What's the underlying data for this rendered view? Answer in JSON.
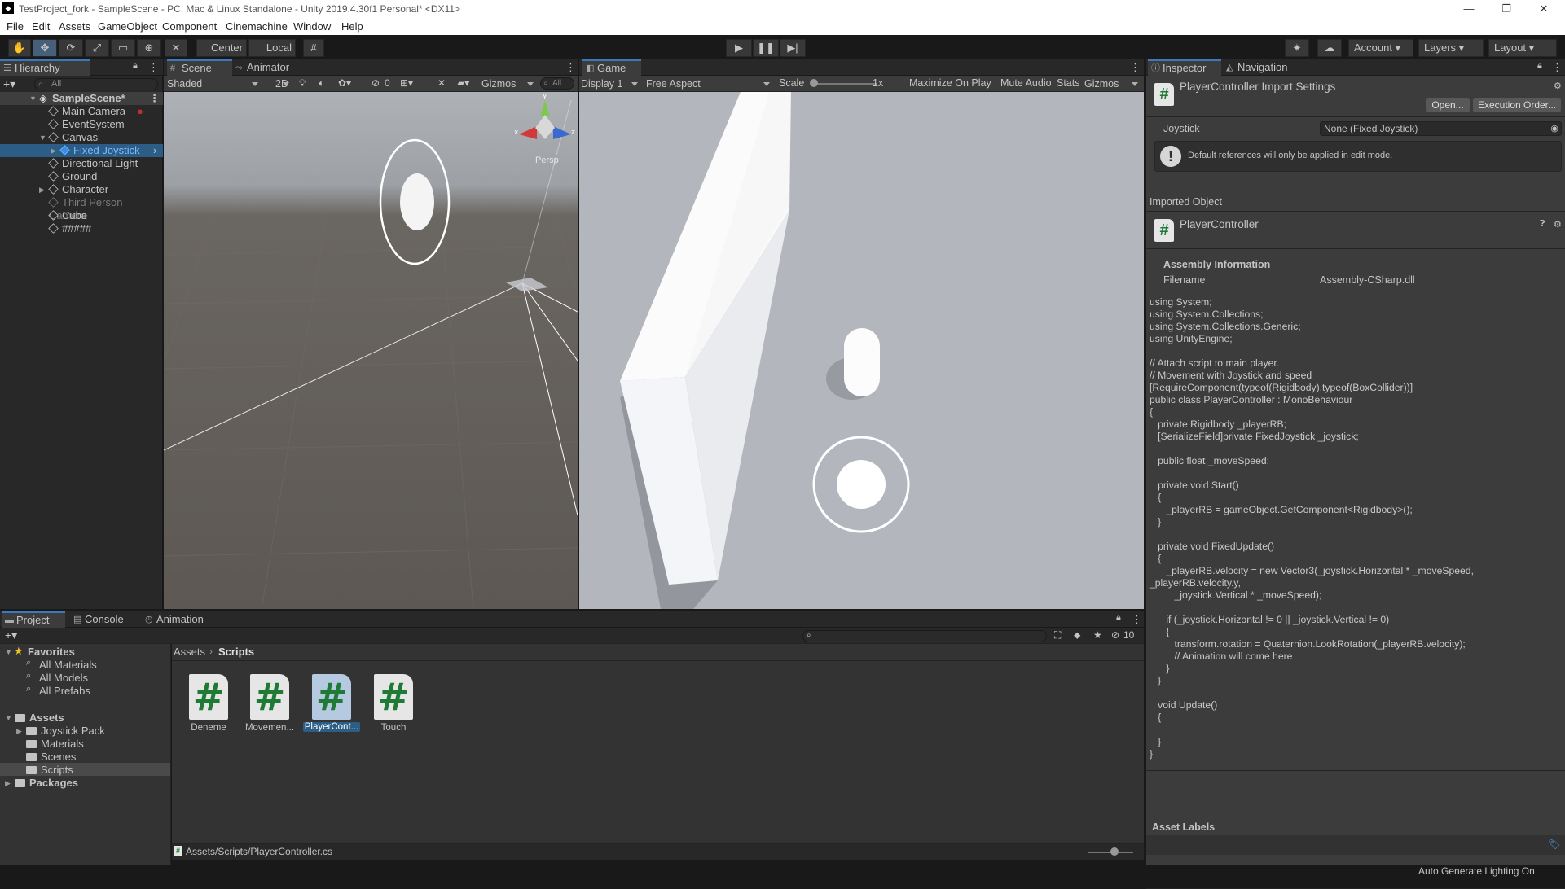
{
  "window": {
    "title": "TestProject_fork - SampleScene - PC, Mac & Linux Standalone - Unity 2019.4.30f1 Personal* <DX11>",
    "app_icon": "unity-logo-icon"
  },
  "menu": [
    "File",
    "Edit",
    "Assets",
    "GameObject",
    "Component",
    "Cinemachine",
    "Window",
    "Help"
  ],
  "toolbar": {
    "pivot": "Center",
    "space": "Local",
    "account": "Account",
    "layers": "Layers",
    "layout": "Layout"
  },
  "hierarchy": {
    "tab": "Hierarchy",
    "search_placeholder": "All",
    "scene": "SampleScene*",
    "items": [
      "Main Camera",
      "EventSystem",
      "Canvas",
      "Fixed Joystick",
      "Directional Light",
      "Ground",
      "Character",
      "Third Person Camera",
      "Cube",
      "#####"
    ]
  },
  "scene": {
    "tabs": [
      "Scene",
      "Animator"
    ],
    "shading": "Shaded",
    "mode2d": "2D",
    "hidden_count": "0",
    "gizmos": "Gizmos",
    "search_placeholder": "All",
    "persp": "Persp",
    "axis_y": "y",
    "axis_x": "x",
    "axis_z": "z"
  },
  "game": {
    "tab": "Game",
    "display": "Display 1",
    "aspect": "Free Aspect",
    "scale_label": "Scale",
    "scale_value": "1x",
    "maximize": "Maximize On Play",
    "mute": "Mute Audio",
    "stats": "Stats",
    "gizmos": "Gizmos"
  },
  "inspector": {
    "tabs": [
      "Inspector",
      "Navigation"
    ],
    "title": "PlayerController Import Settings",
    "open_btn": "Open...",
    "exec_btn": "Execution Order...",
    "joystick_label": "Joystick",
    "joystick_value": "None (Fixed Joystick)",
    "warning": "Default references will only be applied in edit mode.",
    "imported_object": "Imported Object",
    "object_name": "PlayerController",
    "assembly_info": "Assembly Information",
    "filename_label": "Filename",
    "filename_value": "Assembly-CSharp.dll",
    "code": "using System;\nusing System.Collections;\nusing System.Collections.Generic;\nusing UnityEngine;\n\n// Attach script to main player.\n// Movement with Joystick and speed\n[RequireComponent(typeof(Rigidbody),typeof(BoxCollider))]\npublic class PlayerController : MonoBehaviour\n{\n   private Rigidbody _playerRB;\n   [SerializeField]private FixedJoystick _joystick;\n\n   public float _moveSpeed;\n\n   private void Start()\n   {\n      _playerRB = gameObject.GetComponent<Rigidbody>();\n   }\n\n   private void FixedUpdate()\n   {\n      _playerRB.velocity = new Vector3(_joystick.Horizontal * _moveSpeed,\n_playerRB.velocity.y,\n         _joystick.Vertical * _moveSpeed);\n\n      if (_joystick.Horizontal != 0 || _joystick.Vertical != 0)\n      {\n         transform.rotation = Quaternion.LookRotation(_playerRB.velocity);\n         // Animation will come here\n      }\n   }\n\n   void Update()\n   {\n\n   }\n}",
    "asset_labels": "Asset Labels"
  },
  "project": {
    "tabs": [
      "Project",
      "Console",
      "Animation"
    ],
    "hidden_count": "10",
    "favorites": "Favorites",
    "fav_items": [
      "All Materials",
      "All Models",
      "All Prefabs"
    ],
    "assets": "Assets",
    "asset_folders": [
      "Joystick Pack",
      "Materials",
      "Scenes",
      "Scripts"
    ],
    "packages": "Packages",
    "breadcrumb": [
      "Assets",
      "Scripts"
    ],
    "files": [
      "Deneme",
      "Movemen...",
      "PlayerCont...",
      "Touch"
    ],
    "status_path": "Assets/Scripts/PlayerController.cs"
  },
  "statusbar": {
    "text": "Auto Generate Lighting On"
  },
  "colors": {
    "accent": "#3a79bb",
    "selection": "#2c5d87",
    "script_green": "#1f7a35"
  }
}
